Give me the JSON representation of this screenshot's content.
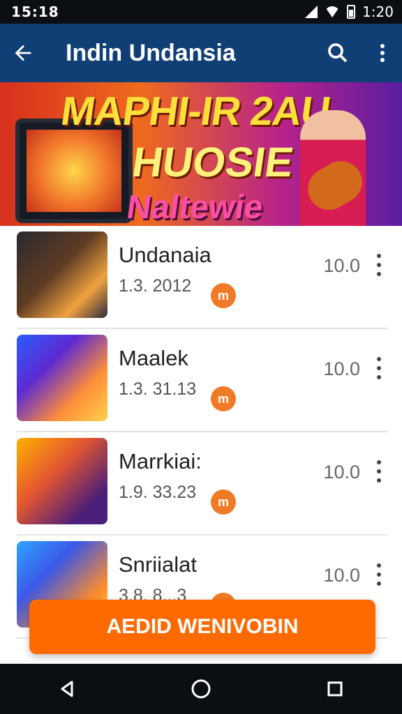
{
  "status_bar": {
    "time_left": "15:18",
    "time_right": "1:20"
  },
  "appbar": {
    "title": "Indin Undansia",
    "back_icon": "back-arrow-icon",
    "search_icon": "search-icon",
    "more_icon": "more-vert-icon"
  },
  "banner": {
    "line1": "MAPHI-IR 2AU",
    "line2": "HUOSIE",
    "line3": "Naltewie"
  },
  "list": {
    "items": [
      {
        "title": "Undanaia",
        "subtitle": "1.3. 2012",
        "badge": "m",
        "rating": "10.0"
      },
      {
        "title": "Maalek",
        "subtitle": "1.3. 31.13",
        "badge": "m",
        "rating": "10.0"
      },
      {
        "title": "Marrkiai:",
        "subtitle": "1.9. 33.23",
        "badge": "m",
        "rating": "10.0"
      },
      {
        "title": "Snriialat",
        "subtitle": "3.8. 8...3",
        "badge": "m",
        "rating": "10.0"
      }
    ]
  },
  "cta": {
    "label": "AEDID WENIVOBIN"
  },
  "colors": {
    "appbar": "#0f3f75",
    "accent": "#ff6a00",
    "badge": "#f07a25"
  }
}
